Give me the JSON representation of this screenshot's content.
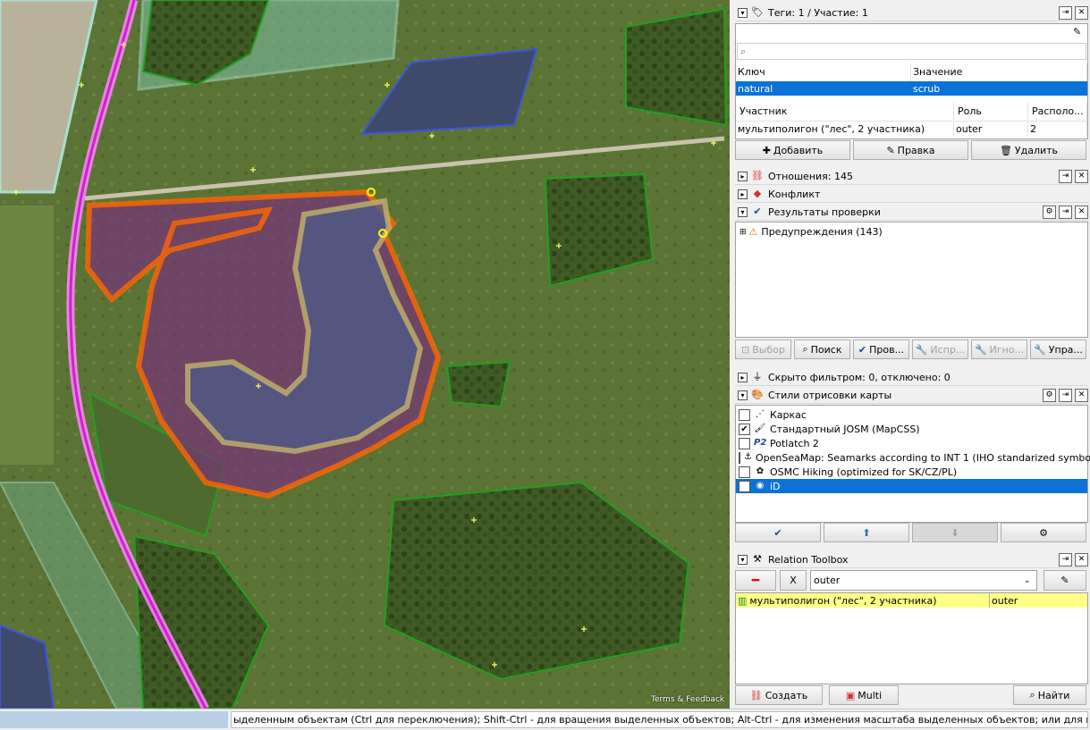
{
  "map": {
    "attribution": "Terms & Feedback"
  },
  "tags_panel": {
    "title": "Теги: 1 / Участие: 1",
    "search_placeholder": "",
    "col_key": "Ключ",
    "col_value": "Значение",
    "tags": [
      {
        "key": "natural",
        "value": "scrub"
      }
    ],
    "membership_cols": {
      "member": "Участник",
      "role": "Роль",
      "position": "Располо..."
    },
    "memberships": [
      {
        "member": "мультиполигон (\"лес\", 2 участника)",
        "role": "outer",
        "position": "2"
      }
    ],
    "add_label": "Добавить",
    "edit_label": "Правка",
    "delete_label": "Удалить"
  },
  "relations_panel": {
    "title": "Отношения: 145"
  },
  "conflict_panel": {
    "title": "Конфликт"
  },
  "validation_panel": {
    "title": "Результаты проверки",
    "warnings": "Предупреждения (143)",
    "buttons": [
      "Выбор",
      "Поиск",
      "Пров...",
      "Испр...",
      "Игно...",
      "Упра..."
    ]
  },
  "filter_panel": {
    "title": "Скрыто фильтром: 0, отключено: 0"
  },
  "styles_panel": {
    "title": "Стили отрисовки карты",
    "styles": [
      {
        "label": "Каркас",
        "checked": false,
        "selected": false,
        "icon": "wireframe-icon"
      },
      {
        "label": "Стандартный JOSM (MapCSS)",
        "checked": true,
        "selected": false,
        "icon": "josm-icon"
      },
      {
        "label": "Potlatch 2",
        "checked": false,
        "selected": false,
        "icon": "p2-icon"
      },
      {
        "label": "OpenSeaMap: Seamarks according to INT 1 (IHO standarized symbols)",
        "checked": false,
        "selected": false,
        "icon": "seamark-icon"
      },
      {
        "label": "OSMC Hiking (optimized for SK/CZ/PL)",
        "checked": false,
        "selected": false,
        "icon": "hiking-icon"
      },
      {
        "label": "iD",
        "checked": false,
        "selected": true,
        "icon": "id-icon"
      }
    ],
    "p2_glyph": "P2"
  },
  "relation_toolbox": {
    "title": "Relation Toolbox",
    "role_value": "outer",
    "x_label": "X",
    "member_name": "мультиполигон (\"лес\", 2 участника)",
    "member_role": "outer",
    "create_label": "Создать",
    "multi_label": "Multi",
    "find_label": "Найти"
  },
  "status_bar": {
    "message": "ыделенным объектам (Ctrl для переключения); Shift-Ctrl - для вращения выделенных объектов; Alt-Ctrl - для изменения масштаба выделенных объектов; или для изменения выделения"
  },
  "colors": {
    "selection": "#0b72d8",
    "highlight": "#ffff88",
    "relation_orange": "#ff6600"
  }
}
